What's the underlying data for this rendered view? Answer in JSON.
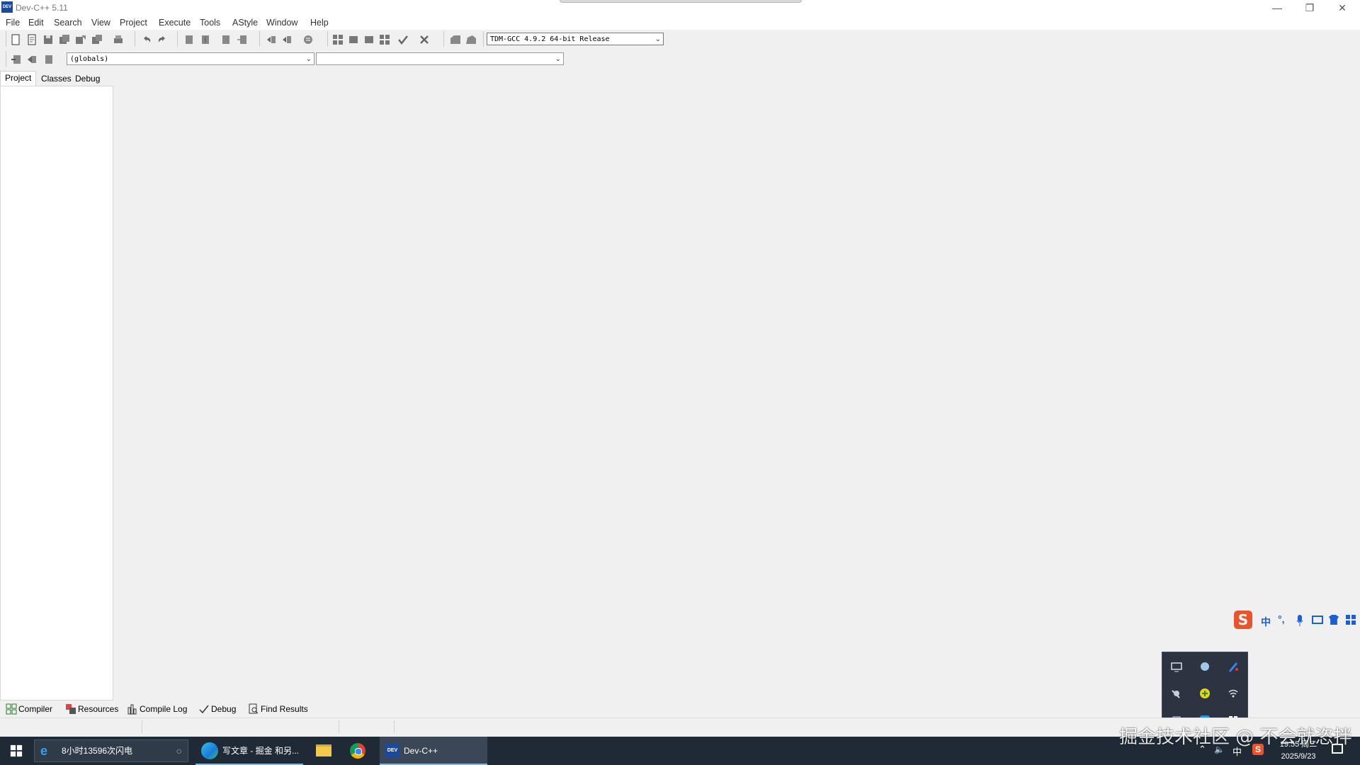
{
  "window": {
    "title": "Dev-C++ 5.11",
    "app_icon_text": "DEV"
  },
  "menu": [
    "File",
    "Edit",
    "Search",
    "View",
    "Project",
    "Execute",
    "Tools",
    "AStyle",
    "Window",
    "Help"
  ],
  "toolbar": {
    "compiler_select": "TDM-GCC 4.9.2 64-bit Release",
    "scope_select": "(globals)",
    "member_select": ""
  },
  "left_panel": {
    "tabs": [
      "Project",
      "Classes",
      "Debug"
    ],
    "active_tab": "Project"
  },
  "bottom_tabs": [
    "Compiler",
    "Resources",
    "Compile Log",
    "Debug",
    "Find Results"
  ],
  "taskbar": {
    "search_text": "8小时13596次闪电",
    "apps": [
      {
        "name": "edge",
        "label": "写文章 - 掘金 和另..."
      },
      {
        "name": "file-explorer",
        "label": ""
      },
      {
        "name": "chrome",
        "label": ""
      },
      {
        "name": "devcpp",
        "label": "Dev-C++",
        "icon_text": "DEV"
      }
    ],
    "ime_lang": "中",
    "time": "19:55 周二",
    "date": "2025/9/23"
  },
  "ime_toolbar": {
    "label": "中",
    "punct": "°,"
  },
  "watermark": "掘金技术社区 @ 不会就恣拌",
  "colors": {
    "taskbar": "#1f2a36",
    "accent": "#76b9ed",
    "sogou": "#e8542c"
  }
}
